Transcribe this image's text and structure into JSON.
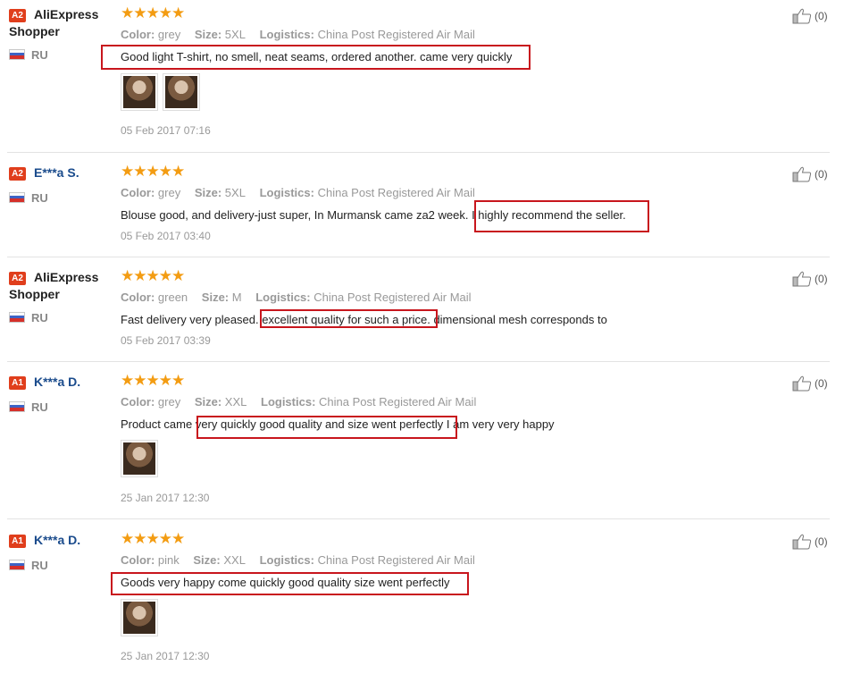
{
  "reviews": [
    {
      "badge": "A2",
      "user_line1": "AliExpress",
      "user_line2": "Shopper",
      "country": "RU",
      "rating": "★★★★★",
      "color_label": "Color:",
      "color_value": "grey",
      "size_label": "Size:",
      "size_value": "5XL",
      "logistics_label": "Logistics:",
      "logistics_value": "China Post Registered Air Mail",
      "text": "Good light T-shirt, no smell, neat seams, ordered another. came very quickly",
      "date": "05 Feb 2017 07:16",
      "likes": "(0)"
    },
    {
      "badge": "A2",
      "user_line1": "E***a S.",
      "country": "RU",
      "rating": "★★★★★",
      "color_label": "Color:",
      "color_value": "grey",
      "size_label": "Size:",
      "size_value": "5XL",
      "logistics_label": "Logistics:",
      "logistics_value": "China Post Registered Air Mail",
      "text": "Blouse good, and delivery-just super, In Murmansk came za2 week. I highly recommend the seller.",
      "date": "05 Feb 2017 03:40",
      "likes": "(0)"
    },
    {
      "badge": "A2",
      "user_line1": "AliExpress",
      "user_line2": "Shopper",
      "country": "RU",
      "rating": "★★★★★",
      "color_label": "Color:",
      "color_value": "green",
      "size_label": "Size:",
      "size_value": "M",
      "logistics_label": "Logistics:",
      "logistics_value": "China Post Registered Air Mail",
      "text": "Fast delivery very pleased. excellent quality for such a price. dimensional mesh corresponds to",
      "date": "05 Feb 2017 03:39",
      "likes": "(0)"
    },
    {
      "badge": "A1",
      "user_line1": "K***a D.",
      "country": "RU",
      "rating": "★★★★★",
      "color_label": "Color:",
      "color_value": "grey",
      "size_label": "Size:",
      "size_value": "XXL",
      "logistics_label": "Logistics:",
      "logistics_value": "China Post Registered Air Mail",
      "text": "Product came very quickly good quality and size went perfectly I am very very happy",
      "date": "25 Jan 2017 12:30",
      "likes": "(0)"
    },
    {
      "badge": "A1",
      "user_line1": "K***a D.",
      "country": "RU",
      "rating": "★★★★★",
      "color_label": "Color:",
      "color_value": "pink",
      "size_label": "Size:",
      "size_value": "XXL",
      "logistics_label": "Logistics:",
      "logistics_value": "China Post Registered Air Mail",
      "text": "Goods very happy come quickly good quality size went perfectly",
      "date": "25 Jan 2017 12:30",
      "likes": "(0)"
    }
  ],
  "colors": {
    "badge": "#e03e1c",
    "star": "#f39c12",
    "highlight_box": "#c8161d",
    "username": "#1a4b8c"
  },
  "icons": {
    "like": "thumbs-up-icon",
    "flag": "russia-flag-icon",
    "rating": "star-icon"
  }
}
